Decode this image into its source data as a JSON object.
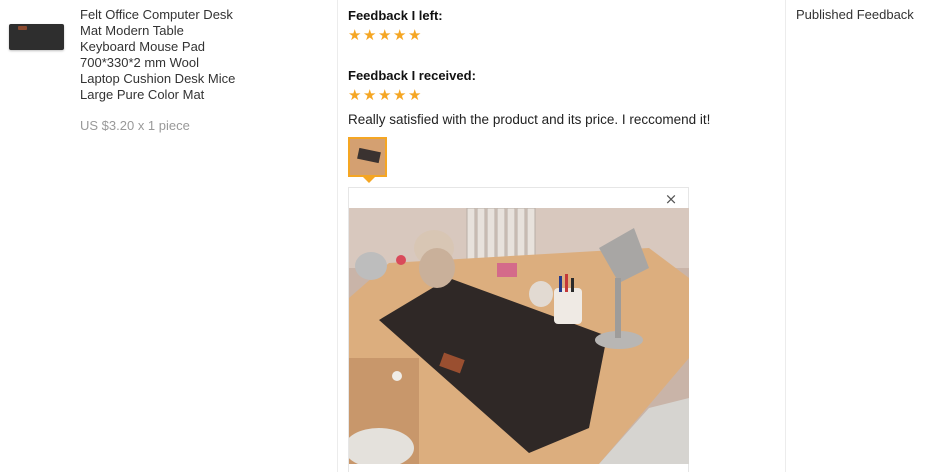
{
  "product": {
    "title_lines": [
      "Felt Office Computer Desk",
      "Mat Modern Table",
      "Keyboard Mouse Pad",
      "700*330*2 mm Wool",
      "Laptop Cushion Desk Mice",
      "Large Pure Color Mat"
    ],
    "price_text": "US $3.20 x 1 piece"
  },
  "feedback_left": {
    "heading": "Feedback I left:",
    "rating": 5
  },
  "feedback_received": {
    "heading": "Feedback I received:",
    "rating": 5,
    "comment": "Really satisfied with the product and its price. I reccomend it!"
  },
  "preview": {
    "close_symbol": "×"
  },
  "status": {
    "label": "Published Feedback"
  },
  "colors": {
    "star": "#f5a623",
    "thumb_border": "#f5a623"
  },
  "icons": {
    "star": "star-icon",
    "close": "close-icon"
  }
}
